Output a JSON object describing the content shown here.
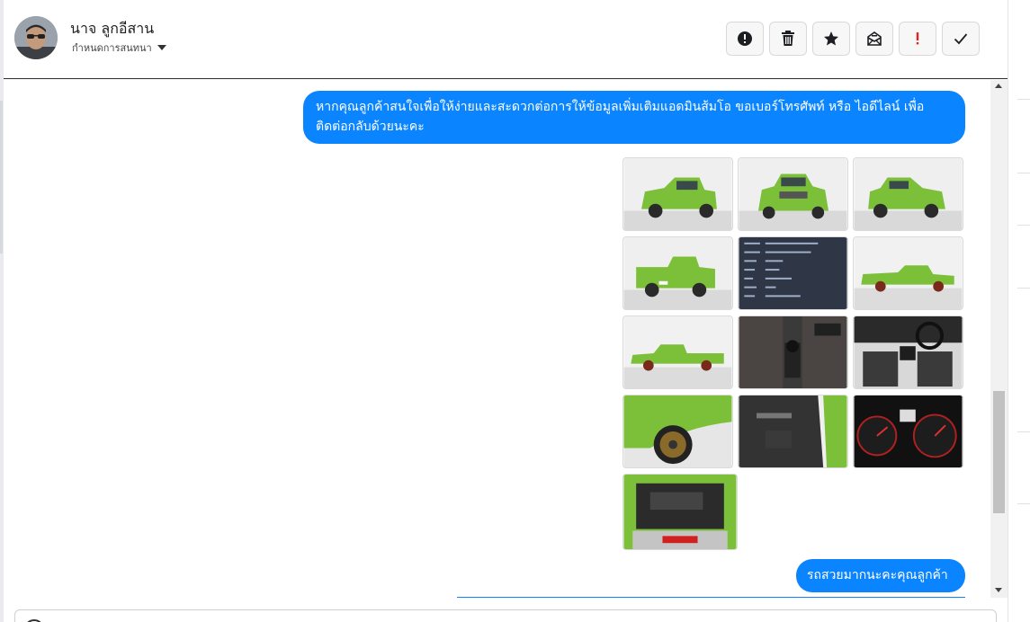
{
  "header": {
    "contact_name": "นาจ ลูกอีสาน",
    "assign_label": "กำหนดการสนทนา",
    "actions": [
      {
        "name": "mark-spam-button",
        "icon": "alert-circle-icon"
      },
      {
        "name": "delete-button",
        "icon": "trash-icon"
      },
      {
        "name": "star-button",
        "icon": "star-icon"
      },
      {
        "name": "mark-unread-button",
        "icon": "envelope-icon"
      },
      {
        "name": "mark-important-button",
        "icon": "exclamation-icon"
      },
      {
        "name": "mark-done-button",
        "icon": "check-icon"
      }
    ]
  },
  "messages": {
    "msg1": "หากคุณลูกค้าสนใจเพื่อให้ง่ายและสะดวกต่อการให้ข้อมูลเพิ่มเติมแอดมินส้มโอ ขอเบอร์โทรศัพท์ หรือ ไอดีไลน์ เพื่อติดต่อกลับด้วยนะคะ",
    "msg2": "รถสวยมากนะคะคุณลูกค้า"
  },
  "photos": [
    {
      "subject": "truck-front-left"
    },
    {
      "subject": "truck-front"
    },
    {
      "subject": "truck-front-right"
    },
    {
      "subject": "truck-rear"
    },
    {
      "subject": "spec-sheet"
    },
    {
      "subject": "truck-side-right"
    },
    {
      "subject": "truck-side-left"
    },
    {
      "subject": "gear-shifter"
    },
    {
      "subject": "dashboard"
    },
    {
      "subject": "wheel-closeup"
    },
    {
      "subject": "door-interior"
    },
    {
      "subject": "gauge-cluster"
    },
    {
      "subject": "engine-bay"
    }
  ],
  "colors": {
    "bubble": "#0b84ff",
    "truck_green": "#7cc03a"
  }
}
